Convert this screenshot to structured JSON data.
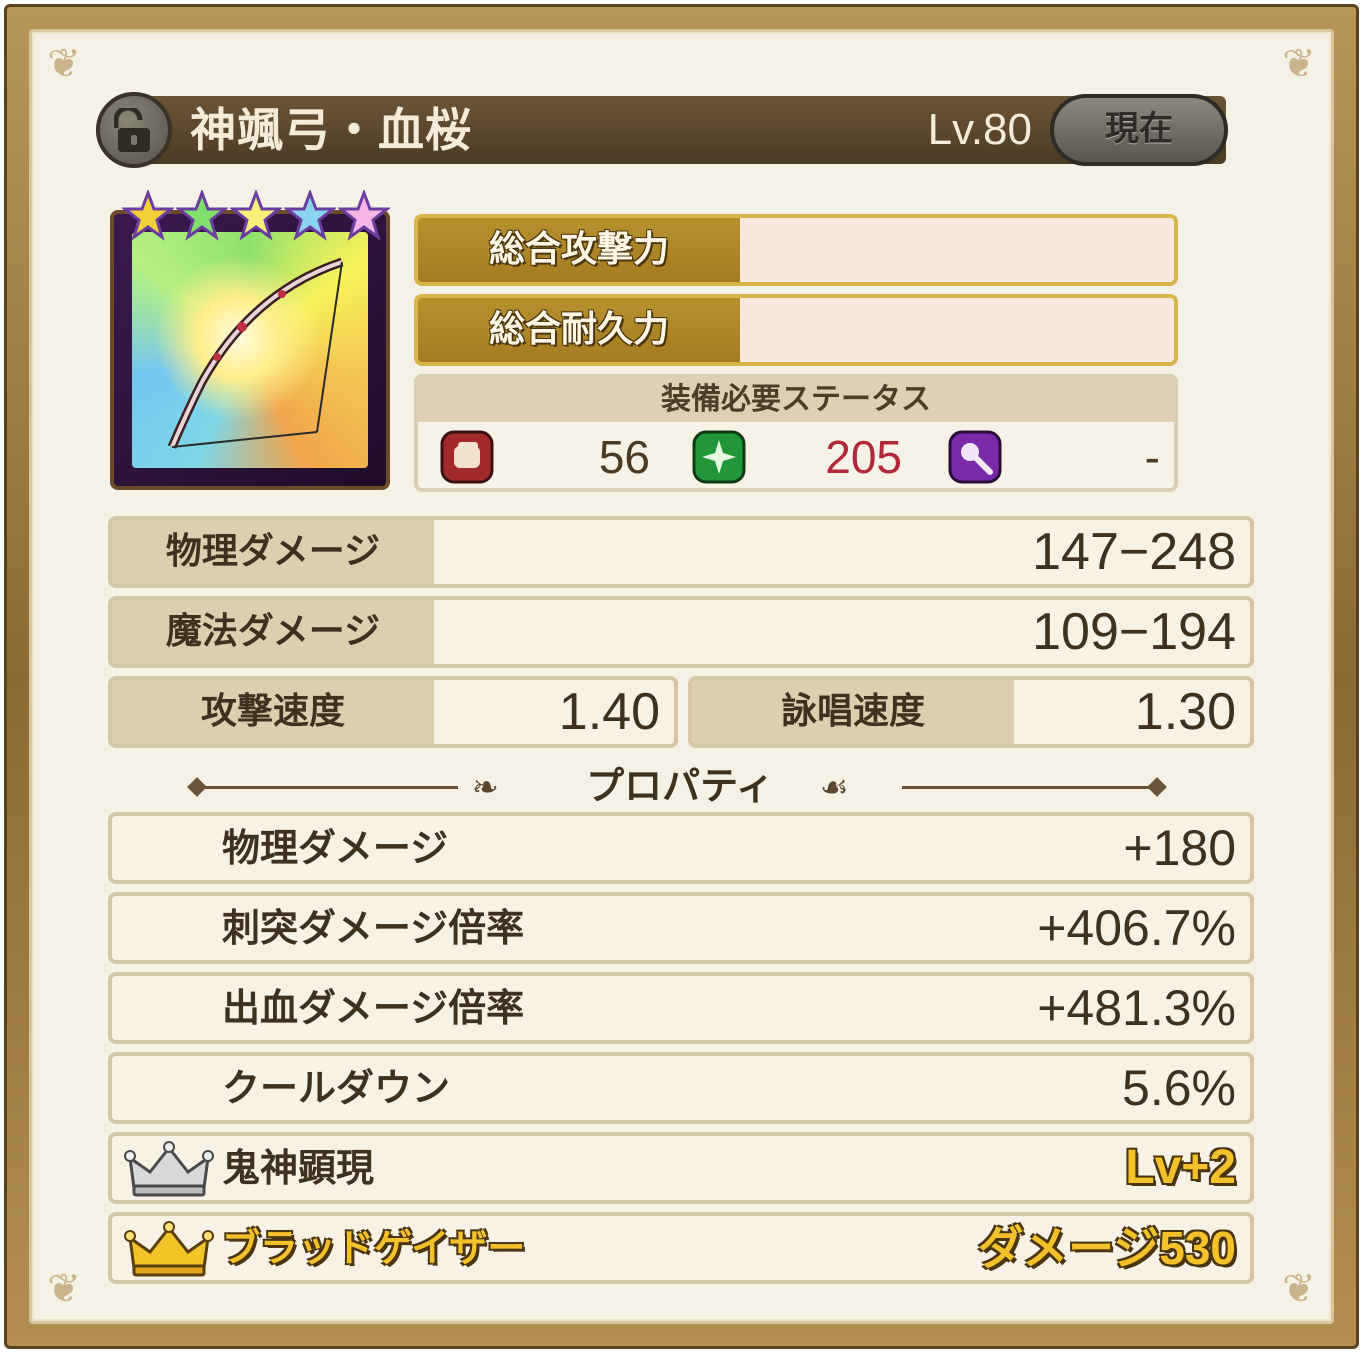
{
  "header": {
    "item_name": "神颯弓・血桜",
    "level": "Lv.80",
    "current_button": "現在",
    "rarity_stars": 5
  },
  "totals": [
    {
      "label": "総合攻撃力",
      "value": ""
    },
    {
      "label": "総合耐久力",
      "value": ""
    }
  ],
  "requirements": {
    "title": "装備必要ステータス",
    "items": [
      {
        "icon": "fist-icon",
        "value": "56",
        "color": "#4a3a26"
      },
      {
        "icon": "green-star-icon",
        "value": "205",
        "color": "#b0283a"
      },
      {
        "icon": "magic-staff-icon",
        "value": "-",
        "color": "#4a3a26"
      }
    ]
  },
  "stats": {
    "physical_damage": {
      "label": "物理ダメージ",
      "value": "147−248"
    },
    "magic_damage": {
      "label": "魔法ダメージ",
      "value": "109−194"
    },
    "attack_speed": {
      "label": "攻撃速度",
      "value": "1.40"
    },
    "cast_speed": {
      "label": "詠唱速度",
      "value": "1.30"
    }
  },
  "properties": {
    "title": "プロパティ",
    "items": [
      {
        "name": "物理ダメージ",
        "value": "+180"
      },
      {
        "name": "刺突ダメージ倍率",
        "value": "+406.7%"
      },
      {
        "name": "出血ダメージ倍率",
        "value": "+481.3%"
      },
      {
        "name": "クールダウン",
        "value": "5.6%"
      },
      {
        "name": "鬼神顕現",
        "value": "Lv+2",
        "crown": "silver-crown-icon"
      },
      {
        "name": "ブラッドゲイザー",
        "value": "ダメージ530",
        "crown": "gold-crown-icon"
      }
    ]
  },
  "colors": {
    "frame": "#8c6a33",
    "header_bar": "#4b3b25",
    "panel_bg": "#f8f2e6",
    "label_bg": "#dccfaf",
    "gold_label": "#b8912e",
    "gold_text": "#f3c22a"
  }
}
